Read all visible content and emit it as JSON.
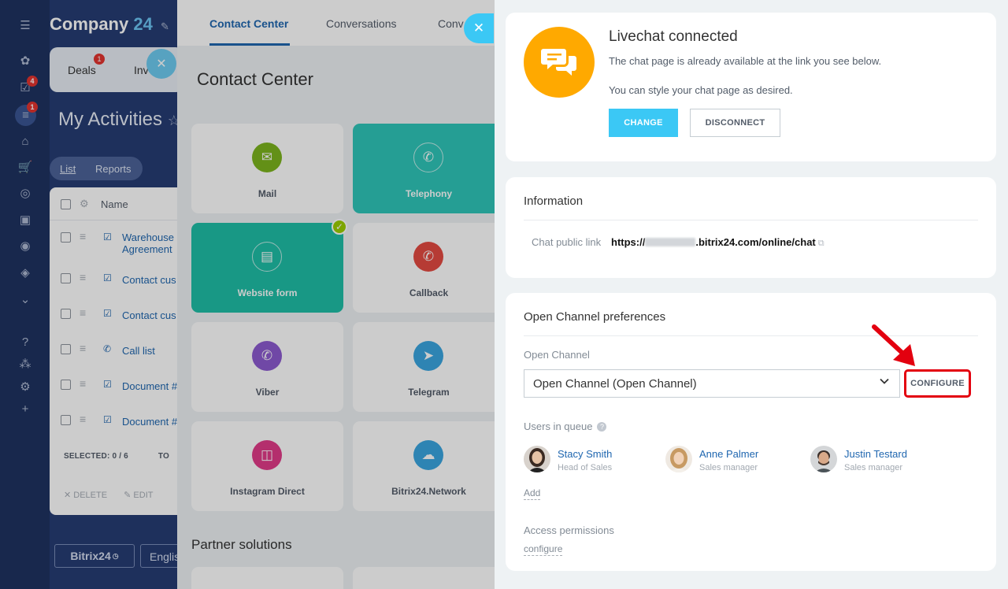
{
  "background": {
    "company": "Company",
    "company_num": "24",
    "tabs": [
      {
        "label": "Deals",
        "badge": "1"
      },
      {
        "label": "Inv"
      }
    ],
    "rail_badges": [
      "4",
      "1"
    ],
    "heading": "My Activities",
    "switch": {
      "list": "List",
      "reports": "Reports"
    },
    "grid": {
      "header_name": "Name",
      "rows": [
        {
          "line1": "Warehouse",
          "line2": "Agreement"
        },
        {
          "line1": "Contact cus"
        },
        {
          "line1": "Contact cus"
        },
        {
          "line1": "Call list"
        },
        {
          "line1": "Document #"
        },
        {
          "line1": "Document #"
        }
      ],
      "selected": "SELECTED: 0 / 6",
      "total": "TO",
      "delete": "DELETE",
      "edit": "EDIT"
    },
    "logo": "Bitrix24",
    "language": "Englis"
  },
  "contact_center": {
    "tabs": [
      "Contact Center",
      "Conversations",
      "Conv"
    ],
    "title": "Contact Center",
    "tiles": [
      {
        "label": "Mail",
        "icon": "mail-icon",
        "color": "#7cb41d"
      },
      {
        "label": "Telephony",
        "icon": "phone-icon",
        "color": "#ffffff"
      },
      {
        "label": "Website form",
        "icon": "form-icon",
        "color": "#ffffff"
      },
      {
        "label": "Callback",
        "icon": "callback-icon",
        "color": "#e44a42"
      },
      {
        "label": "Viber",
        "icon": "viber-icon",
        "color": "#8c5ad0"
      },
      {
        "label": "Telegram",
        "icon": "telegram-icon",
        "color": "#3aa6e0"
      },
      {
        "label": "Instagram Direct",
        "icon": "instagram-icon",
        "color": "#e23b89"
      },
      {
        "label": "Bitrix24.Network",
        "icon": "cloud-icon",
        "color": "#3aa6e0"
      }
    ],
    "partner": "Partner solutions"
  },
  "livechat": {
    "title": "Livechat connected",
    "text1": "The chat page is already available at the link you see below.",
    "text2": "You can style your chat page as desired.",
    "change": "CHANGE",
    "disconnect": "DISCONNECT",
    "accent": "#ffa900",
    "button_color": "#3bc8f5"
  },
  "information": {
    "title": "Information",
    "label": "Chat public link",
    "link_prefix": "https://",
    "link_suffix": ".bitrix24.com/online/chat"
  },
  "preferences": {
    "title": "Open Channel preferences",
    "channel_label": "Open Channel",
    "channel_value": "Open Channel (Open Channel)",
    "configure": "CONFIGURE",
    "queue_label": "Users in queue",
    "users": [
      {
        "name": "Stacy Smith",
        "role": "Head of Sales"
      },
      {
        "name": "Anne Palmer",
        "role": "Sales manager"
      },
      {
        "name": "Justin Testard",
        "role": "Sales manager"
      }
    ],
    "add": "Add",
    "access_label": "Access permissions",
    "access_link": "configure",
    "highlight_color": "#e3000f"
  }
}
